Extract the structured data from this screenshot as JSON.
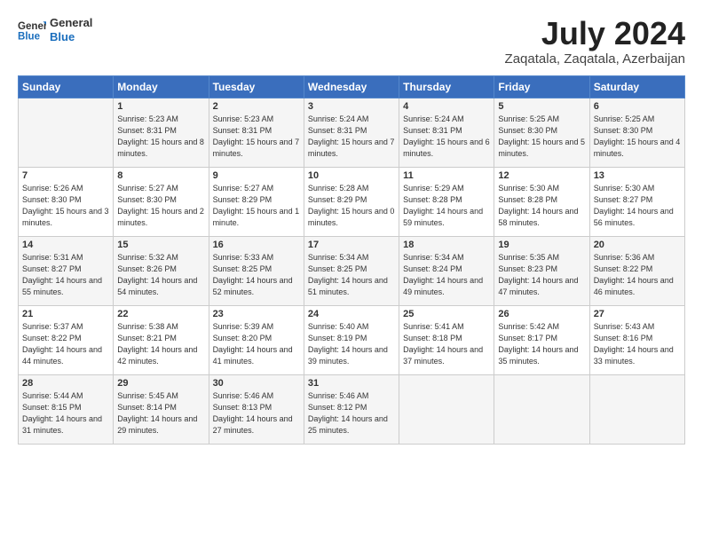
{
  "logo": {
    "line1": "General",
    "line2": "Blue"
  },
  "title": "July 2024",
  "location": "Zaqatala, Zaqatala, Azerbaijan",
  "weekdays": [
    "Sunday",
    "Monday",
    "Tuesday",
    "Wednesday",
    "Thursday",
    "Friday",
    "Saturday"
  ],
  "weeks": [
    [
      {
        "day": "",
        "sunrise": "",
        "sunset": "",
        "daylight": ""
      },
      {
        "day": "1",
        "sunrise": "Sunrise: 5:23 AM",
        "sunset": "Sunset: 8:31 PM",
        "daylight": "Daylight: 15 hours and 8 minutes."
      },
      {
        "day": "2",
        "sunrise": "Sunrise: 5:23 AM",
        "sunset": "Sunset: 8:31 PM",
        "daylight": "Daylight: 15 hours and 7 minutes."
      },
      {
        "day": "3",
        "sunrise": "Sunrise: 5:24 AM",
        "sunset": "Sunset: 8:31 PM",
        "daylight": "Daylight: 15 hours and 7 minutes."
      },
      {
        "day": "4",
        "sunrise": "Sunrise: 5:24 AM",
        "sunset": "Sunset: 8:31 PM",
        "daylight": "Daylight: 15 hours and 6 minutes."
      },
      {
        "day": "5",
        "sunrise": "Sunrise: 5:25 AM",
        "sunset": "Sunset: 8:30 PM",
        "daylight": "Daylight: 15 hours and 5 minutes."
      },
      {
        "day": "6",
        "sunrise": "Sunrise: 5:25 AM",
        "sunset": "Sunset: 8:30 PM",
        "daylight": "Daylight: 15 hours and 4 minutes."
      }
    ],
    [
      {
        "day": "7",
        "sunrise": "Sunrise: 5:26 AM",
        "sunset": "Sunset: 8:30 PM",
        "daylight": "Daylight: 15 hours and 3 minutes."
      },
      {
        "day": "8",
        "sunrise": "Sunrise: 5:27 AM",
        "sunset": "Sunset: 8:30 PM",
        "daylight": "Daylight: 15 hours and 2 minutes."
      },
      {
        "day": "9",
        "sunrise": "Sunrise: 5:27 AM",
        "sunset": "Sunset: 8:29 PM",
        "daylight": "Daylight: 15 hours and 1 minute."
      },
      {
        "day": "10",
        "sunrise": "Sunrise: 5:28 AM",
        "sunset": "Sunset: 8:29 PM",
        "daylight": "Daylight: 15 hours and 0 minutes."
      },
      {
        "day": "11",
        "sunrise": "Sunrise: 5:29 AM",
        "sunset": "Sunset: 8:28 PM",
        "daylight": "Daylight: 14 hours and 59 minutes."
      },
      {
        "day": "12",
        "sunrise": "Sunrise: 5:30 AM",
        "sunset": "Sunset: 8:28 PM",
        "daylight": "Daylight: 14 hours and 58 minutes."
      },
      {
        "day": "13",
        "sunrise": "Sunrise: 5:30 AM",
        "sunset": "Sunset: 8:27 PM",
        "daylight": "Daylight: 14 hours and 56 minutes."
      }
    ],
    [
      {
        "day": "14",
        "sunrise": "Sunrise: 5:31 AM",
        "sunset": "Sunset: 8:27 PM",
        "daylight": "Daylight: 14 hours and 55 minutes."
      },
      {
        "day": "15",
        "sunrise": "Sunrise: 5:32 AM",
        "sunset": "Sunset: 8:26 PM",
        "daylight": "Daylight: 14 hours and 54 minutes."
      },
      {
        "day": "16",
        "sunrise": "Sunrise: 5:33 AM",
        "sunset": "Sunset: 8:25 PM",
        "daylight": "Daylight: 14 hours and 52 minutes."
      },
      {
        "day": "17",
        "sunrise": "Sunrise: 5:34 AM",
        "sunset": "Sunset: 8:25 PM",
        "daylight": "Daylight: 14 hours and 51 minutes."
      },
      {
        "day": "18",
        "sunrise": "Sunrise: 5:34 AM",
        "sunset": "Sunset: 8:24 PM",
        "daylight": "Daylight: 14 hours and 49 minutes."
      },
      {
        "day": "19",
        "sunrise": "Sunrise: 5:35 AM",
        "sunset": "Sunset: 8:23 PM",
        "daylight": "Daylight: 14 hours and 47 minutes."
      },
      {
        "day": "20",
        "sunrise": "Sunrise: 5:36 AM",
        "sunset": "Sunset: 8:22 PM",
        "daylight": "Daylight: 14 hours and 46 minutes."
      }
    ],
    [
      {
        "day": "21",
        "sunrise": "Sunrise: 5:37 AM",
        "sunset": "Sunset: 8:22 PM",
        "daylight": "Daylight: 14 hours and 44 minutes."
      },
      {
        "day": "22",
        "sunrise": "Sunrise: 5:38 AM",
        "sunset": "Sunset: 8:21 PM",
        "daylight": "Daylight: 14 hours and 42 minutes."
      },
      {
        "day": "23",
        "sunrise": "Sunrise: 5:39 AM",
        "sunset": "Sunset: 8:20 PM",
        "daylight": "Daylight: 14 hours and 41 minutes."
      },
      {
        "day": "24",
        "sunrise": "Sunrise: 5:40 AM",
        "sunset": "Sunset: 8:19 PM",
        "daylight": "Daylight: 14 hours and 39 minutes."
      },
      {
        "day": "25",
        "sunrise": "Sunrise: 5:41 AM",
        "sunset": "Sunset: 8:18 PM",
        "daylight": "Daylight: 14 hours and 37 minutes."
      },
      {
        "day": "26",
        "sunrise": "Sunrise: 5:42 AM",
        "sunset": "Sunset: 8:17 PM",
        "daylight": "Daylight: 14 hours and 35 minutes."
      },
      {
        "day": "27",
        "sunrise": "Sunrise: 5:43 AM",
        "sunset": "Sunset: 8:16 PM",
        "daylight": "Daylight: 14 hours and 33 minutes."
      }
    ],
    [
      {
        "day": "28",
        "sunrise": "Sunrise: 5:44 AM",
        "sunset": "Sunset: 8:15 PM",
        "daylight": "Daylight: 14 hours and 31 minutes."
      },
      {
        "day": "29",
        "sunrise": "Sunrise: 5:45 AM",
        "sunset": "Sunset: 8:14 PM",
        "daylight": "Daylight: 14 hours and 29 minutes."
      },
      {
        "day": "30",
        "sunrise": "Sunrise: 5:46 AM",
        "sunset": "Sunset: 8:13 PM",
        "daylight": "Daylight: 14 hours and 27 minutes."
      },
      {
        "day": "31",
        "sunrise": "Sunrise: 5:46 AM",
        "sunset": "Sunset: 8:12 PM",
        "daylight": "Daylight: 14 hours and 25 minutes."
      },
      {
        "day": "",
        "sunrise": "",
        "sunset": "",
        "daylight": ""
      },
      {
        "day": "",
        "sunrise": "",
        "sunset": "",
        "daylight": ""
      },
      {
        "day": "",
        "sunrise": "",
        "sunset": "",
        "daylight": ""
      }
    ]
  ]
}
